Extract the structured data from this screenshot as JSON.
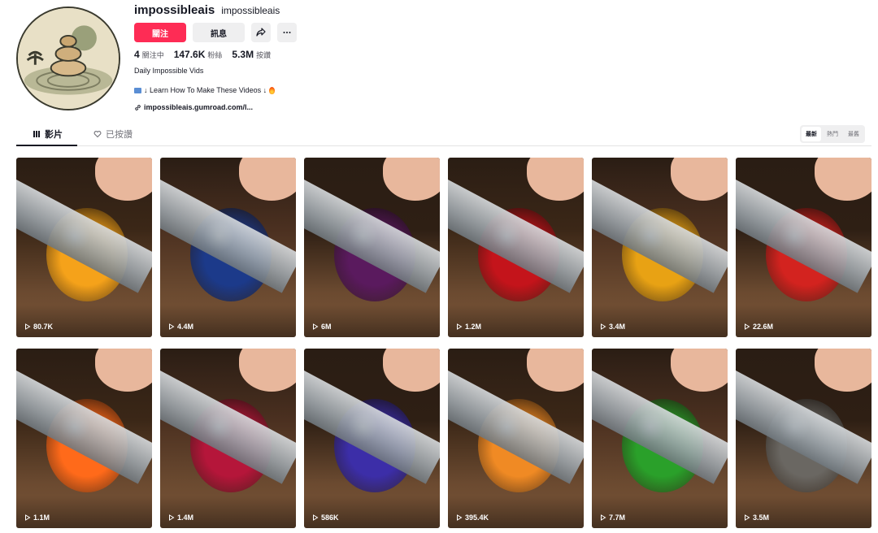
{
  "profile": {
    "username": "impossibleais",
    "handle": "impossibleais",
    "follow_label": "關注",
    "message_label": "訊息",
    "stats": [
      {
        "num": "4",
        "label": "關注中"
      },
      {
        "num": "147.6K",
        "label": "粉絲"
      },
      {
        "num": "5.3M",
        "label": "按讚"
      }
    ],
    "bio": "Daily Impossible Vids",
    "bio_line2": "↓ Learn How To Make These Videos ↓",
    "link": "impossibleais.gumroad.com/l..."
  },
  "tabs": [
    {
      "label": "影片",
      "icon": "grid-icon"
    },
    {
      "label": "已按讚",
      "icon": "heart-icon"
    }
  ],
  "sort": [
    "最新",
    "熱門",
    "最舊"
  ],
  "videos": [
    {
      "views": "80.7K",
      "color": "#f5a21a"
    },
    {
      "views": "4.4M",
      "color": "#1c3a8a"
    },
    {
      "views": "6M",
      "color": "#5a1a5e"
    },
    {
      "views": "1.2M",
      "color": "#c4141b"
    },
    {
      "views": "3.4M",
      "color": "#e8a214"
    },
    {
      "views": "22.6M",
      "color": "#d3231f"
    },
    {
      "views": "1.1M",
      "color": "#ff6a1a"
    },
    {
      "views": "1.4M",
      "color": "#b5163a"
    },
    {
      "views": "586K",
      "color": "#3c2ea8"
    },
    {
      "views": "395.4K",
      "color": "#f08a24"
    },
    {
      "views": "7.7M",
      "color": "#2aa02a"
    },
    {
      "views": "3.5M",
      "color": "#6a6762"
    }
  ]
}
